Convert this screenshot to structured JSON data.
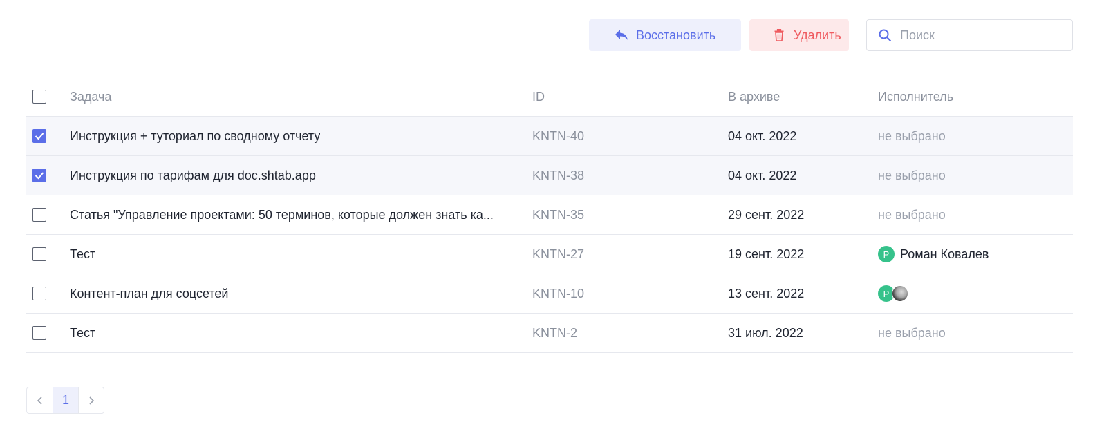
{
  "toolbar": {
    "restore_label": "Восстановить",
    "delete_label": "Удалить",
    "search_placeholder": "Поиск",
    "search_value": ""
  },
  "table": {
    "headers": {
      "task": "Задача",
      "id": "ID",
      "archived": "В архиве",
      "assignee": "Исполнитель"
    },
    "rows": [
      {
        "selected": true,
        "task": "Инструкция + туториал по сводному отчету",
        "id": "KNTN-40",
        "archived": "04 окт. 2022",
        "assignee": "не выбрано"
      },
      {
        "selected": true,
        "task": "Инструкция по тарифам для doc.shtab.app",
        "id": "KNTN-38",
        "archived": "04 окт. 2022",
        "assignee": "не выбрано"
      },
      {
        "selected": false,
        "task": "Статья \"Управление проектами: 50 терминов, которые должен знать ка...",
        "id": "KNTN-35",
        "archived": "29 сент. 2022",
        "assignee": "не выбрано"
      },
      {
        "selected": false,
        "task": "Тест",
        "id": "KNTN-27",
        "archived": "19 сент. 2022",
        "assignee_initial": "Р",
        "assignee": "Роман Ковалев"
      },
      {
        "selected": false,
        "task": "Контент-план для соцсетей",
        "id": "KNTN-10",
        "archived": "13 сент. 2022",
        "assignee_initial": "Р"
      },
      {
        "selected": false,
        "task": "Тест",
        "id": "KNTN-2",
        "archived": "31 июл. 2022",
        "assignee": "не выбрано"
      }
    ]
  },
  "pagination": {
    "current_page": "1"
  },
  "colors": {
    "accent": "#5b6ee8",
    "danger": "#ef5a5f",
    "avatar": "#36c28b"
  },
  "icons": {
    "restore": "reply-arrow-icon",
    "delete": "trash-icon",
    "search": "search-icon",
    "prev": "chevron-left-icon",
    "next": "chevron-right-icon",
    "check": "checkmark-icon"
  }
}
